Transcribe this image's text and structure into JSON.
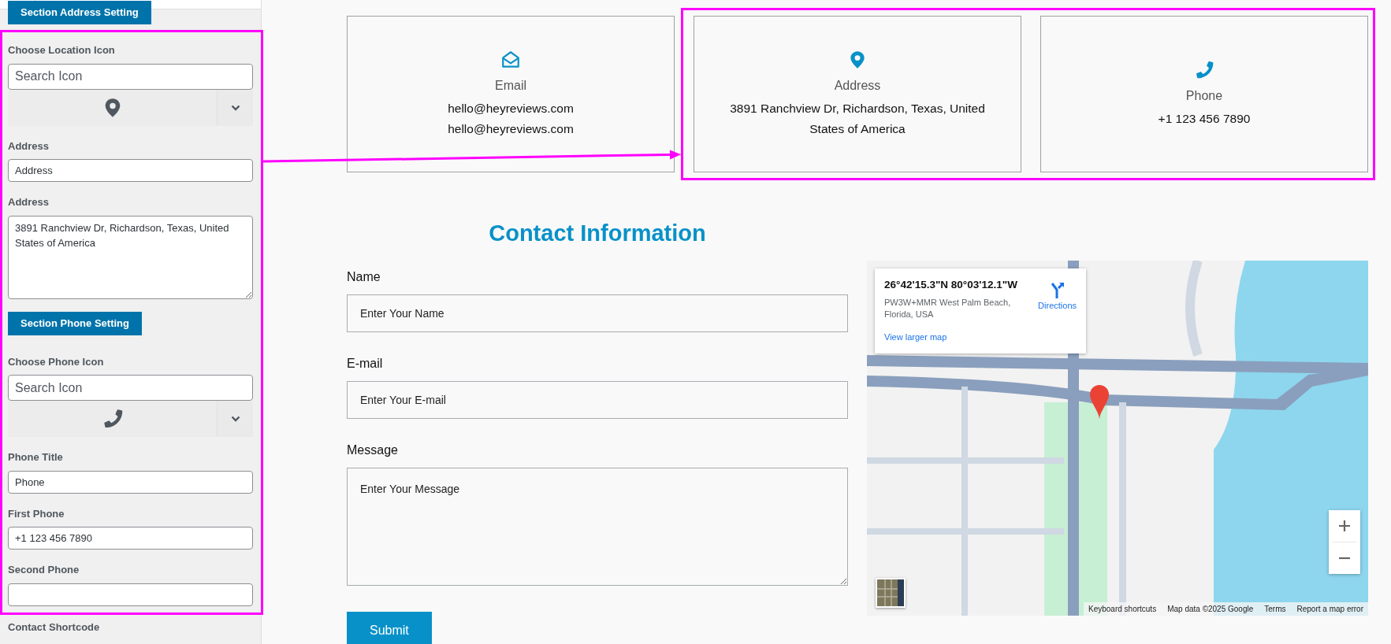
{
  "settings_panel": {
    "section_button": "Section Address Setting",
    "highlighted_items": [
      {
        "kind": "location_icon_picker",
        "label": "Choose Location Icon",
        "placeholder": "Search Icon"
      },
      {
        "kind": "text",
        "label": "Address",
        "value": "Address"
      },
      {
        "kind": "textarea",
        "label": "Address",
        "value": "3891 Ranchview Dr, Richardson, Texas, United States of America"
      },
      {
        "kind": "section_button",
        "label": "Section Phone Setting"
      },
      {
        "kind": "phone_icon_picker",
        "label": "Choose Phone Icon",
        "placeholder": "Search Icon"
      },
      {
        "kind": "text",
        "label": "Phone Title",
        "value": "Phone"
      },
      {
        "kind": "text",
        "label": "First Phone",
        "value": "+1 123 456 7890"
      },
      {
        "kind": "text",
        "label": "Second Phone"
      }
    ],
    "after_label": "Contact Shortcode"
  },
  "info_cards": [
    {
      "kind": "email",
      "title": "Email",
      "lines": [
        "hello@heyreviews.com",
        "hello@heyreviews.com"
      ],
      "highlighted": false
    },
    {
      "kind": "address",
      "title": "Address",
      "lines": [
        "3891 Ranchview Dr, Richardson, Texas, United States of America"
      ],
      "highlighted": true
    },
    {
      "kind": "phone",
      "title": "Phone",
      "lines": [
        "+1 123 456 7890"
      ],
      "highlighted": true
    }
  ],
  "contact_form": {
    "title": "Contact Information",
    "fields": [
      {
        "kind": "input",
        "label": "Name",
        "placeholder": "Enter Your Name"
      },
      {
        "kind": "input",
        "label": "E-mail",
        "placeholder": "Enter Your E-mail"
      },
      {
        "kind": "textarea",
        "label": "Message",
        "placeholder": "Enter Your Message"
      }
    ],
    "submit": "Submit"
  },
  "map": {
    "info_card": {
      "coordinates": "26°42'15.3\"N 80°03'12.1\"W",
      "address": "PW3W+MMR West Palm Beach, Florida, USA",
      "directions": "Directions",
      "larger_map_link": "View larger map"
    },
    "attribution": [
      "Keyboard shortcuts",
      "Map data ©2025 Google",
      "Terms",
      "Report a map error"
    ]
  }
}
